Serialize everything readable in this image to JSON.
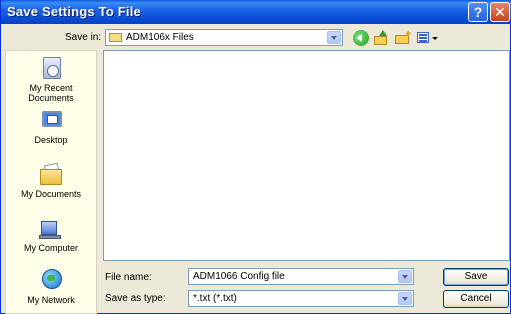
{
  "window": {
    "title": "Save Settings To File",
    "help_glyph": "?",
    "close_glyph": "✕"
  },
  "toolbar": {
    "save_in_label": "Save in:",
    "save_in_value": "ADM106x Files",
    "icons": [
      "back-icon",
      "up-folder-icon",
      "new-folder-icon",
      "views-menu-icon"
    ]
  },
  "places": [
    {
      "label": "My Recent Documents",
      "icon": "recent-documents-icon"
    },
    {
      "label": "Desktop",
      "icon": "desktop-icon"
    },
    {
      "label": "My Documents",
      "icon": "my-documents-icon"
    },
    {
      "label": "My Computer",
      "icon": "my-computer-icon"
    },
    {
      "label": "My Network",
      "icon": "my-network-icon"
    }
  ],
  "form": {
    "file_name_label": "File name:",
    "file_name_value": "ADM1066 Config file",
    "save_as_type_label": "Save as type:",
    "save_as_type_value": "*.txt (*.txt)",
    "save_button": "Save",
    "cancel_button": "Cancel"
  },
  "colors": {
    "titlebar": "#0a5ae0",
    "dialog_bg": "#ece9d8",
    "places_bg": "#fffee8"
  }
}
